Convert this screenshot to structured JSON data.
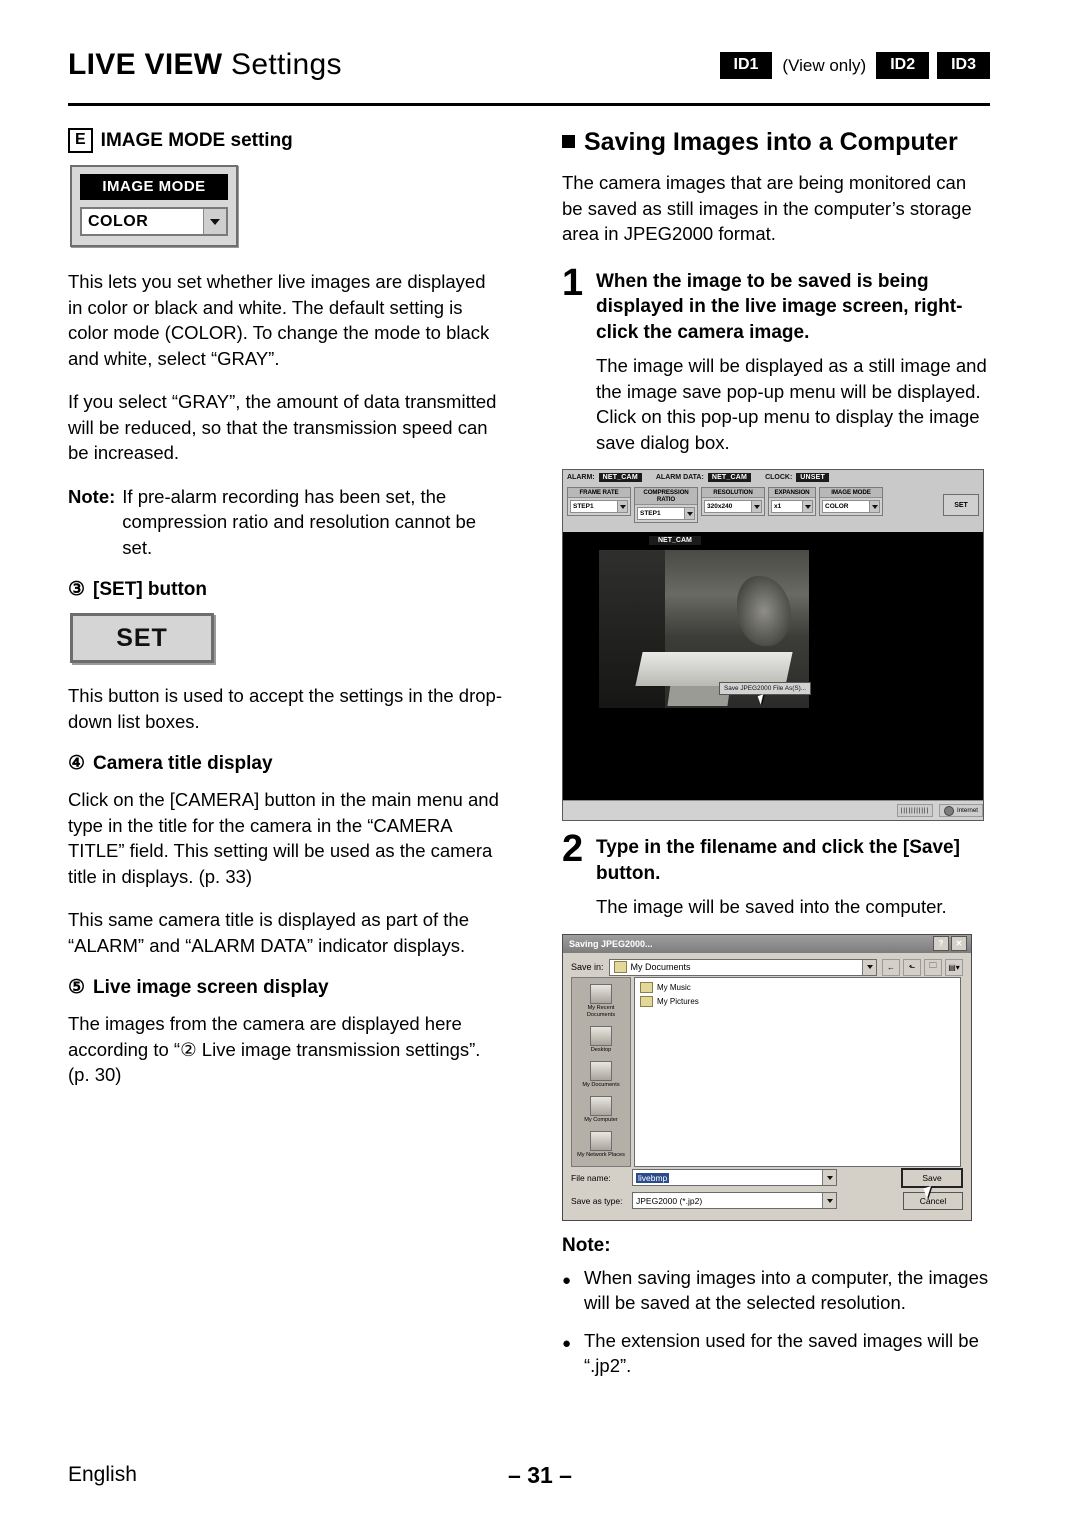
{
  "header": {
    "title_bold": "LIVE VIEW",
    "title_light": " Settings",
    "id1": "ID1",
    "view_only": "(View only)",
    "id2": "ID2",
    "id3": "ID3"
  },
  "left": {
    "section_letter": "E",
    "section_title": "IMAGE MODE setting",
    "image_mode_widget": {
      "title": "IMAGE MODE",
      "value": "COLOR"
    },
    "para1": "This lets you set whether live images are displayed in color or black and white. The default setting is color mode (COLOR). To change the mode to black and white, select “GRAY”.",
    "para2": "If you select “GRAY”, the amount of data transmitted will be reduced, so that the transmission speed can be increased.",
    "note_label": "Note:",
    "note_text": "If pre-alarm recording has been set, the compression ratio and resolution cannot be set.",
    "item3_num": "③",
    "item3_title": "[SET] button",
    "set_button_label": "SET",
    "para3": "This button is used to accept the settings in the drop-down list boxes.",
    "item4_num": "④",
    "item4_title": "Camera title display",
    "para4": "Click on the [CAMERA] button in the main menu and type in the title for the camera in the “CAMERA TITLE” field. This setting will be used as the camera title in displays. (p. 33)",
    "para5": "This same camera title is displayed as part of the “ALARM” and “ALARM DATA” indicator displays.",
    "item5_num": "⑤",
    "item5_title": "Live image screen display",
    "para6": "The images from the camera are displayed here according to “② Live image transmission settings”. (p. 30)"
  },
  "right": {
    "section_title": "Saving Images into a Computer",
    "intro": "The camera images that are being monitored can be saved as still images in the computer’s storage area in JPEG2000 format.",
    "step1_num": "1",
    "step1_title": "When the image to be saved is being displayed in the live image screen, right-click the camera image.",
    "step1_body": "The image will be displayed as a still image and the image save pop-up menu will be displayed. Click on this pop-up menu to display the image save dialog box.",
    "step2_num": "2",
    "step2_title": "Type in the filename and click the [Save] button.",
    "step2_body": "The image will be saved into the computer.",
    "note_head": "Note:",
    "bullet1": "When saving images into a computer, the images will be saved at the selected resolution.",
    "bullet2": "The extension used for the saved images will be “.jp2”.",
    "liveview_shot": {
      "alarm_label": "ALARM:",
      "alarm_value": "NET_CAM",
      "alarm_data_label": "ALARM DATA:",
      "alarm_data_value": "NET_CAM",
      "clock_label": "CLOCK:",
      "clock_value": "UNSET",
      "controls": [
        {
          "header": "FRAME RATE",
          "value": "STEP1"
        },
        {
          "header": "COMPRESSION RATIO",
          "value": "STEP1"
        },
        {
          "header": "RESOLUTION",
          "value": "320x240"
        },
        {
          "header": "EXPANSION",
          "value": "x1"
        },
        {
          "header": "IMAGE MODE",
          "value": "COLOR"
        }
      ],
      "set_label": "SET",
      "camera_label": "NET_CAM",
      "popup_menu": "Save JPEG2000 File As(S)...",
      "status_cells": "|||||||||||",
      "status_net": "Internet"
    },
    "save_dialog": {
      "title": "Saving JPEG2000...",
      "help_btn": "?",
      "close_btn": "✕",
      "save_in_label": "Save in:",
      "save_in_value": "My Documents",
      "files": [
        "My Music",
        "My Pictures"
      ],
      "places": [
        "My Recent Documents",
        "Desktop",
        "My Documents",
        "My Computer",
        "My Network Places"
      ],
      "filename_label": "File name:",
      "filename_value": "livebmp",
      "savetype_label": "Save as type:",
      "savetype_value": "JPEG2000 (*.jp2)",
      "save_button": "Save",
      "cancel_button": "Cancel"
    }
  },
  "footer": {
    "language": "English",
    "page_number": "– 31 –"
  }
}
